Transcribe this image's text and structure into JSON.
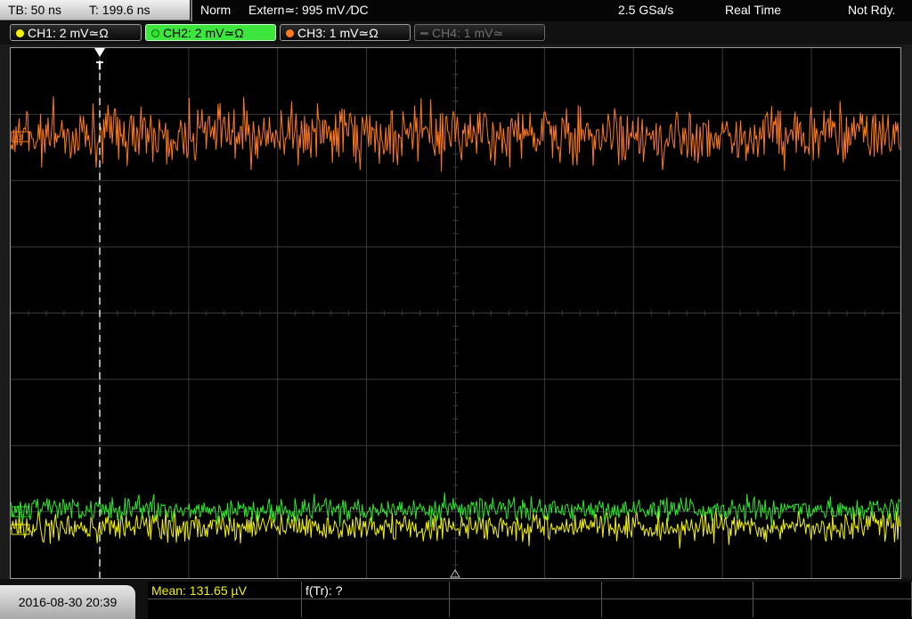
{
  "header": {
    "timebase": "TB: 50 ns",
    "trigger_time": "T: 199.6 ns",
    "acq_mode": "Norm",
    "trigger_source": "Extern≃: 995 mV ∕DC",
    "sample_rate": "2.5 GSa/s",
    "mode": "Real Time",
    "status": "Not Rdy."
  },
  "channels": [
    {
      "label": "CH1: 2 mV≃Ω",
      "color": "#f2f20a",
      "state": "on"
    },
    {
      "label": "CH2: 2 mV≃Ω",
      "color": "#2ee62e",
      "state": "selected"
    },
    {
      "label": "CH3: 1 mV≃Ω",
      "color": "#ff7a1c",
      "state": "on"
    },
    {
      "label": "CH4: 1 mV≃",
      "color": "#777777",
      "state": "off"
    }
  ],
  "screen": {
    "trigger_marker": "T",
    "markers": {
      "ch3": "3",
      "ch2": "2",
      "ch1": "1"
    },
    "colors": {
      "grid": "#3a3a3a",
      "ch1": "#f2f20a",
      "ch2": "#2ee62e",
      "ch3": "#ff7a1c",
      "trigger_line": "#ffffff"
    }
  },
  "footer": {
    "datetime": "2016-08-30 20:39",
    "measurements": [
      {
        "label": "Mean: 131.65 µV",
        "color": "#f2f20a"
      },
      {
        "label": "f(Tr): ?",
        "color": "#ffffff"
      }
    ]
  }
}
